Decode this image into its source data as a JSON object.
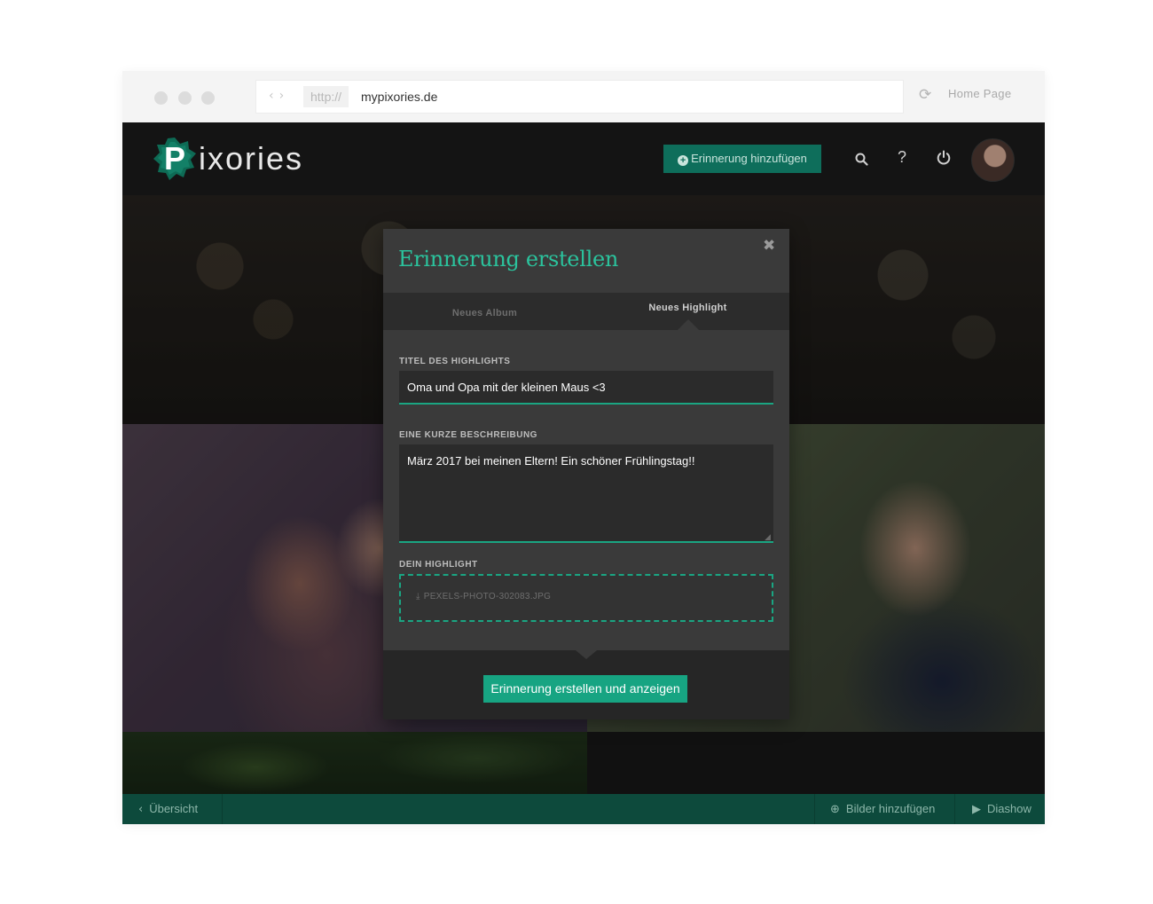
{
  "browser": {
    "protocol": "http://",
    "url": "mypixories.de",
    "home_label": "Home Page"
  },
  "header": {
    "logo_text": "IXORIES",
    "logo_letter": "P",
    "add_memory_label": "Erinnerung hinzufügen",
    "help_label": "?"
  },
  "modal": {
    "title": "Erinnerung erstellen",
    "tabs": [
      {
        "label": "Neues Album",
        "active": false
      },
      {
        "label": "Neues Highlight",
        "active": true
      }
    ],
    "title_field": {
      "label": "TITEL DES HIGHLIGHTS",
      "value": "Oma und Opa mit der kleinen Maus <3"
    },
    "description_field": {
      "label": "EINE KURZE BESCHREIBUNG",
      "value": "März 2017 bei meinen Eltern! Ein schöner Frühlingstag!!"
    },
    "upload_field": {
      "label": "DEIN HIGHLIGHT",
      "filename": "PEXELS-PHOTO-302083.JPG"
    },
    "submit_label": "Erinnerung erstellen und anzeigen"
  },
  "footer": {
    "back_label": "Übersicht",
    "add_images_label": "Bilder hinzufügen",
    "slideshow_label": "Diashow"
  },
  "colors": {
    "accent": "#1aa582",
    "title_green": "#2bc39d",
    "footer_bg": "#0d4a3c",
    "header_button": "#0e6e5b"
  }
}
